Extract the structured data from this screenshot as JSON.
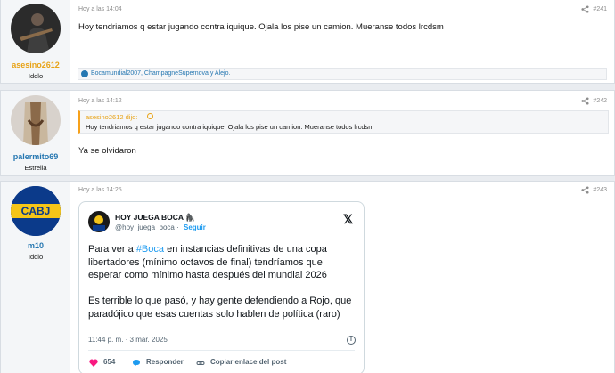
{
  "posts": [
    {
      "username": "asesino2612",
      "user_title": "Idolo",
      "timestamp": "Hoy a las 14:04",
      "number": "#241",
      "text": "Hoy tendriamos q estar jugando contra iquique. Ojala los pise un camion. Mueranse todos lrcdsm",
      "reactions": "Bocamundial2007, ChampagneSupernova y Alejo."
    },
    {
      "username": "palermito69",
      "user_title": "Estrella",
      "timestamp": "Hoy a las 14:12",
      "number": "#242",
      "quote_attribution": "asesino2612 dijo:",
      "quote_text": "Hoy tendriamos q estar jugando contra iquique. Ojala los pise un camion. Mueranse todos lrcdsm",
      "text": "Ya se olvidaron"
    },
    {
      "username": "m10",
      "user_title": "Idolo",
      "timestamp": "Hoy a las 14:25",
      "number": "#243",
      "avatar_text": "CABJ"
    }
  ],
  "tweet": {
    "name": "HOY JUEGA BOCA",
    "name_emoji": "🦍",
    "handle": "@hoy_juega_boca",
    "follow_label": "Seguir",
    "text_before_tag": "Para ver a ",
    "hashtag": "#Boca",
    "text_after_tag": " en instancias definitivas de una copa libertadores (mínimo octavos de final) tendríamos que esperar como mínimo hasta después del mundial 2026",
    "text_second": "Es terrible lo que pasó, y hay gente defendiendo a Rojo, que paradójico que esas cuentas solo hablen de política (raro)",
    "time": "11:44 p. m. · 3 mar. 2025",
    "likes": "654",
    "reply_label": "Responder",
    "copy_label": "Copiar enlace del post"
  },
  "colors": {
    "username_orange": "#e8a317",
    "username_blue": "#2577b1",
    "accent_link": "#1d9bf0"
  }
}
